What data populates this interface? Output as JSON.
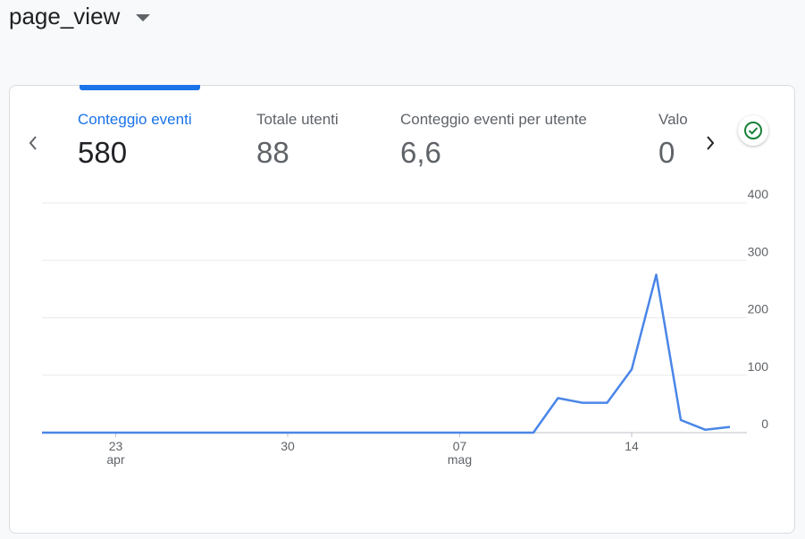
{
  "header": {
    "title": "page_view"
  },
  "metrics": [
    {
      "label": "Conteggio eventi",
      "value": "580"
    },
    {
      "label": "Totale utenti",
      "value": "88"
    },
    {
      "label": "Conteggio eventi per utente",
      "value": "6,6"
    },
    {
      "label": "Valo",
      "value": "0"
    }
  ],
  "icons": {
    "prev": "chevron-left-icon",
    "next": "chevron-right-icon",
    "status": "check-circle-icon",
    "title_menu": "caret-down-icon"
  },
  "colors": {
    "accent": "#1a73e8",
    "line": "#4a86e8",
    "success": "#188038"
  },
  "chart_data": {
    "type": "line",
    "x": [
      "2024-04-20",
      "2024-04-21",
      "2024-04-22",
      "2024-04-23",
      "2024-04-24",
      "2024-04-25",
      "2024-04-26",
      "2024-04-27",
      "2024-04-28",
      "2024-04-29",
      "2024-04-30",
      "2024-05-01",
      "2024-05-02",
      "2024-05-03",
      "2024-05-04",
      "2024-05-05",
      "2024-05-06",
      "2024-05-07",
      "2024-05-08",
      "2024-05-09",
      "2024-05-10",
      "2024-05-11",
      "2024-05-12",
      "2024-05-13",
      "2024-05-14",
      "2024-05-15",
      "2024-05-16",
      "2024-05-17",
      "2024-05-18"
    ],
    "series": [
      {
        "values": [
          0,
          0,
          0,
          0,
          0,
          0,
          0,
          0,
          0,
          0,
          0,
          0,
          0,
          0,
          0,
          0,
          0,
          0,
          0,
          0,
          0,
          60,
          52,
          52,
          110,
          275,
          22,
          5,
          10
        ]
      }
    ],
    "x_ticks": [
      {
        "date": "2024-04-23",
        "day": "23",
        "month": "apr"
      },
      {
        "date": "2024-04-30",
        "day": "30",
        "month": ""
      },
      {
        "date": "2024-05-07",
        "day": "07",
        "month": "mag"
      },
      {
        "date": "2024-05-14",
        "day": "14",
        "month": ""
      }
    ],
    "y_ticks": [
      "0",
      "100",
      "200",
      "300",
      "400"
    ],
    "ylim": [
      0,
      400
    ],
    "grid": true,
    "y_axis_side": "right"
  }
}
